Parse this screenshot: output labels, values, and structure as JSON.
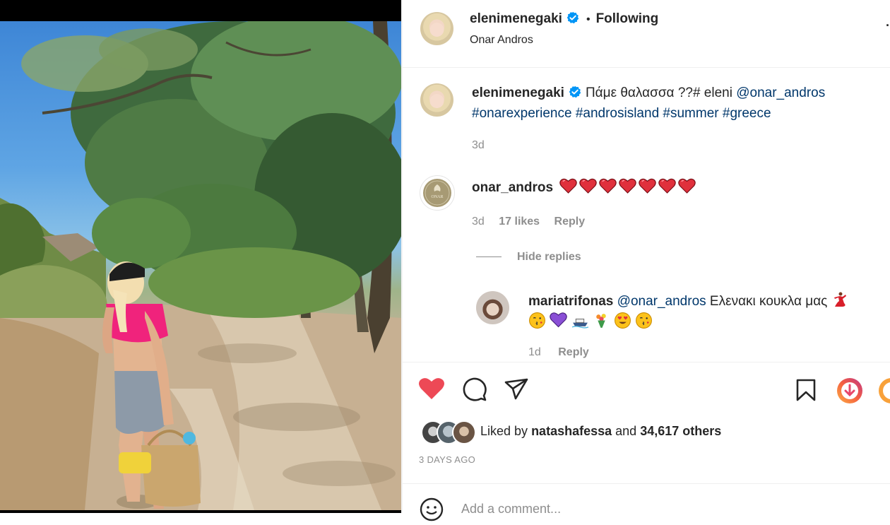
{
  "post": {
    "author": "elenimenegaki",
    "follow_status": "Following",
    "location": "Onar Andros"
  },
  "caption": {
    "author": "elenimenegaki",
    "text": "Πάμε θαλασσα ??# eleni",
    "mention": "@onar_andros",
    "hashtags": [
      "#onarexperience",
      "#androsisland",
      "#summer",
      "#greece"
    ],
    "age": "3d"
  },
  "comment1": {
    "author": "onar_andros",
    "avatar_text": "ONAR",
    "hearts": 7,
    "age": "3d",
    "likes": "17 likes",
    "reply": "Reply",
    "hide_replies": "Hide replies"
  },
  "reply1": {
    "author": "mariatrifonas",
    "mention": "@onar_andros",
    "text": "Ελενακι κουκλα μας",
    "age": "1d",
    "reply": "Reply"
  },
  "likes": {
    "liked_by": "Liked by",
    "user": "natashafessa",
    "and": "and",
    "others": "34,617 others"
  },
  "date": "3 DAYS AGO",
  "add_comment": {
    "placeholder": "Add a comment..."
  },
  "colors": {
    "like_red": "#ed4956",
    "verified_blue": "#0095f6",
    "link": "#00376b"
  }
}
